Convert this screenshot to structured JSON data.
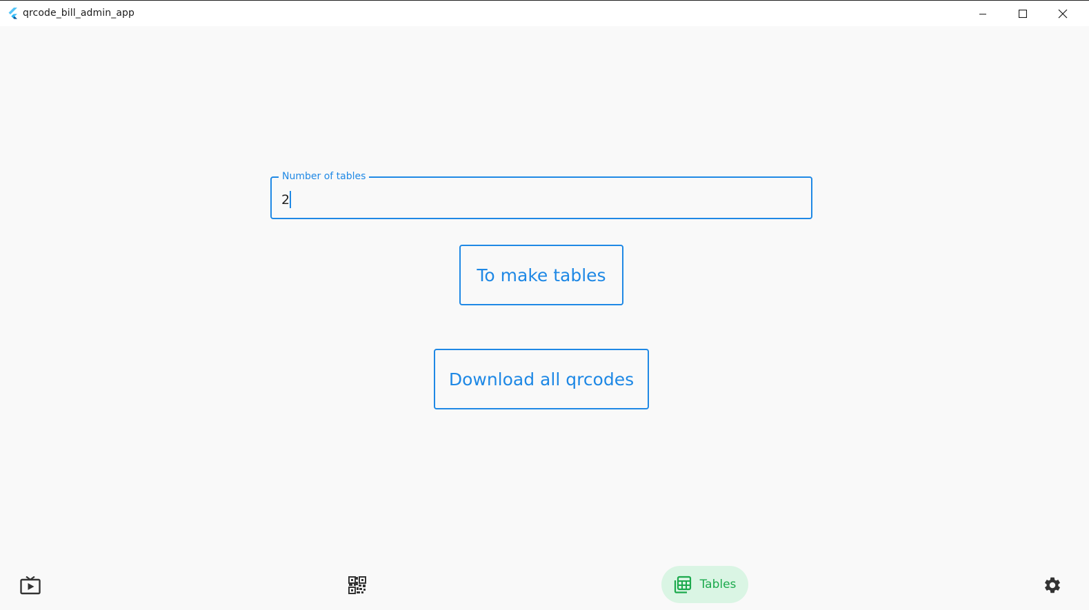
{
  "window": {
    "title": "qrcode_bill_admin_app"
  },
  "form": {
    "field_label": "Number of tables",
    "field_value": "2"
  },
  "buttons": {
    "make_tables": "To make tables",
    "download_all": "Download all qrcodes"
  },
  "bottom_nav": {
    "items": [
      {
        "icon": "live-tv-icon",
        "label": "",
        "selected": false
      },
      {
        "icon": "qr-code-icon",
        "label": "",
        "selected": false
      },
      {
        "icon": "tables-icon",
        "label": "Tables",
        "selected": true
      },
      {
        "icon": "gear-icon",
        "label": "",
        "selected": false
      }
    ]
  },
  "colors": {
    "accent": "#1e88e5",
    "nav_selected_bg": "#daf5e4",
    "nav_selected_fg": "#1ba94c",
    "icon_dark": "#333333"
  }
}
